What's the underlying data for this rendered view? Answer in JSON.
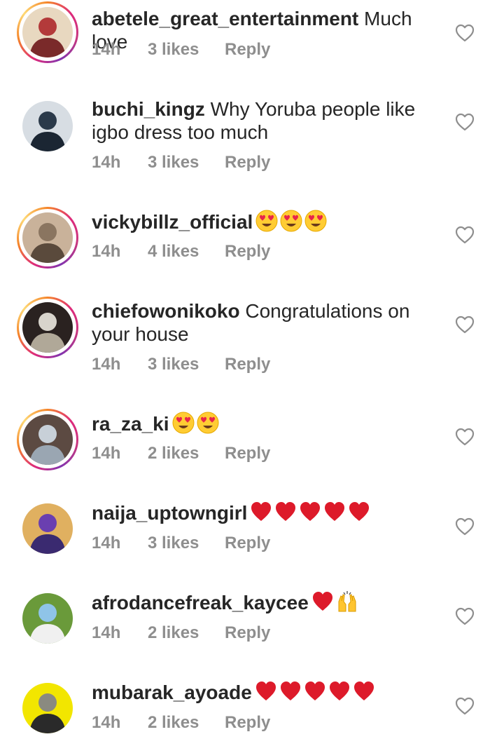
{
  "comments": [
    {
      "username": "abetele_great_entertainment",
      "text": "Much love",
      "emojis": [],
      "time": "14h",
      "likes": "3 likes",
      "reply": "Reply",
      "has_story_ring": true,
      "avatar_palette": [
        "#b33a3a",
        "#e8d8c0",
        "#7a2a2a"
      ]
    },
    {
      "username": "buchi_kingz",
      "text": "Why Yoruba people like igbo dress too much",
      "emojis": [],
      "time": "14h",
      "likes": "3 likes",
      "reply": "Reply",
      "has_story_ring": false,
      "avatar_palette": [
        "#2b3a4a",
        "#d7dde3",
        "#1b2633"
      ]
    },
    {
      "username": "vickybillz_official",
      "text": "",
      "emojis": [
        "heart-eyes-emoji",
        "heart-eyes-emoji",
        "heart-eyes-emoji"
      ],
      "time": "14h",
      "likes": "4 likes",
      "reply": "Reply",
      "has_story_ring": true,
      "avatar_palette": [
        "#8a7560",
        "#c9b29a",
        "#5a4a3c"
      ]
    },
    {
      "username": "chiefowonikoko",
      "text": "Congratulations on your house",
      "emojis": [],
      "time": "14h",
      "likes": "3 likes",
      "reply": "Reply",
      "has_story_ring": true,
      "avatar_palette": [
        "#d8d4cc",
        "#2a2220",
        "#b0a898"
      ]
    },
    {
      "username": "ra_za_ki",
      "text": "",
      "emojis": [
        "heart-eyes-emoji",
        "heart-eyes-emoji"
      ],
      "time": "14h",
      "likes": "2 likes",
      "reply": "Reply",
      "has_story_ring": true,
      "avatar_palette": [
        "#c8d0d8",
        "#5c4a42",
        "#9aa6b2"
      ]
    },
    {
      "username": "naija_uptowngirl",
      "text": "",
      "emojis": [
        "red-heart-emoji",
        "red-heart-emoji",
        "red-heart-emoji",
        "red-heart-emoji",
        "red-heart-emoji"
      ],
      "time": "14h",
      "likes": "3 likes",
      "reply": "Reply",
      "has_story_ring": false,
      "avatar_palette": [
        "#6a3fb0",
        "#e0b060",
        "#3a2a70"
      ]
    },
    {
      "username": "afrodancefreak_kaycee",
      "text": "",
      "emojis": [
        "red-heart-emoji",
        "raising-hands-emoji"
      ],
      "time": "14h",
      "likes": "2 likes",
      "reply": "Reply",
      "has_story_ring": false,
      "avatar_palette": [
        "#8fc4e8",
        "#6a9a3a",
        "#f0f0f0"
      ]
    },
    {
      "username": "mubarak_ayoade",
      "text": "",
      "emojis": [
        "red-heart-emoji",
        "red-heart-emoji",
        "red-heart-emoji",
        "red-heart-emoji",
        "red-heart-emoji"
      ],
      "time": "14h",
      "likes": "2 likes",
      "reply": "Reply",
      "has_story_ring": false,
      "avatar_palette": [
        "#8a8a80",
        "#f2e600",
        "#2a2a2a"
      ]
    }
  ],
  "colors": {
    "text": "#262626",
    "meta": "#8e8e8e",
    "heart": "#e0245e"
  }
}
